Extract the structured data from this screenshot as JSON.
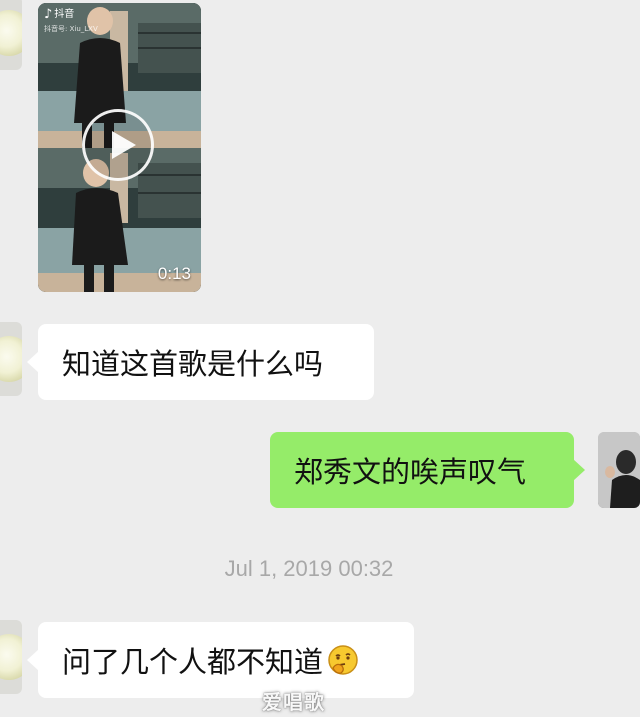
{
  "messages": [
    {
      "type": "video",
      "app_name": "抖音",
      "app_sub": "抖音号: Xiu_LXV",
      "duration": "0:13"
    },
    {
      "type": "text",
      "side": "in",
      "text": "知道这首歌是什么吗"
    },
    {
      "type": "text",
      "side": "out",
      "text": "郑秀文的唉声叹气"
    },
    {
      "type": "timestamp",
      "text": "Jul 1, 2019 00:32"
    },
    {
      "type": "text",
      "side": "in",
      "text": "问了几个人都不知道",
      "emoji": "thinking-face-icon"
    }
  ],
  "watermark": "爱唱歌",
  "colors": {
    "background": "#ededed",
    "incoming_bubble": "#ffffff",
    "outgoing_bubble": "#95ec69",
    "timestamp": "#a8a8a8"
  }
}
